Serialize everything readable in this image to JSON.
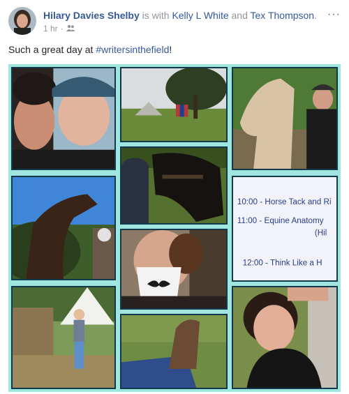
{
  "post": {
    "author": "Hilary Davies Shelby",
    "is_with": "is with",
    "tagged_1": "Kelly L White",
    "and": "and",
    "tagged_2": "Tex Thompson",
    "time": "1 hr",
    "dot": "·",
    "menu": "···",
    "text_prefix": "Such a great day at ",
    "hashtag": "#writersinthefield",
    "text_suffix": "!"
  },
  "whiteboard": {
    "line1": "10:00 - Horse Tack and Ri",
    "line2": "11:00 - Equine Anatomy",
    "line2b": "(Hil",
    "line3": "12:00 - Think Like a H"
  },
  "colors": {
    "link": "#365899",
    "collage_bg": "#9ee6df",
    "tile_border": "#13384a"
  },
  "icons": {
    "privacy": "friends-icon",
    "menu": "more-options-icon"
  }
}
